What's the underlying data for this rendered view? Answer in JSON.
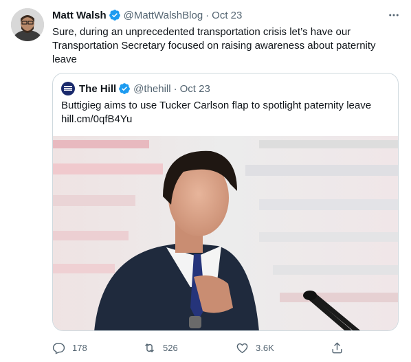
{
  "tweet": {
    "author": {
      "name": "Matt Walsh",
      "handle": "@MattWalshBlog",
      "separator": "·",
      "date": "Oct 23"
    },
    "text": "Sure, during an unprecedented transportation crisis let’s have our Transportation Secretary focused on raising awareness about paternity leave",
    "quote": {
      "author": {
        "name": "The Hill",
        "handle": "@thehill",
        "separator": "·",
        "date": "Oct 23"
      },
      "text": "Buttigieg aims to use Tucker Carlson flap to spotlight paternity leave",
      "link": "hill.cm/0qfB4Yu"
    },
    "actions": {
      "replies": "178",
      "retweets": "526",
      "likes": "3.6K"
    }
  },
  "colors": {
    "verified": "#1d9bf0",
    "secondary_text": "#536471",
    "border": "#cfd9de"
  },
  "icons": [
    "verified-badge-icon",
    "more-icon",
    "reply-icon",
    "retweet-icon",
    "like-icon",
    "share-icon"
  ]
}
